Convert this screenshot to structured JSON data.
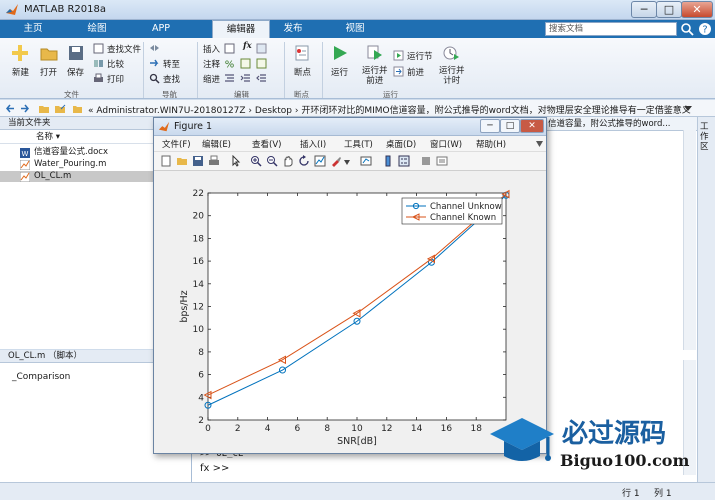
{
  "window": {
    "title": "MATLAB R2018a",
    "min_label": "─",
    "max_label": "□",
    "close_label": "✕"
  },
  "ribbon_tabs": [
    {
      "label": "主页"
    },
    {
      "label": "绘图"
    },
    {
      "label": "APP"
    },
    {
      "label": "编辑器"
    },
    {
      "label": "发布"
    },
    {
      "label": "视图"
    }
  ],
  "search": {
    "placeholder": "搜索文档"
  },
  "ribbon": {
    "file_group": {
      "label": "文件",
      "new": "新建",
      "open": "打开",
      "save": "保存",
      "find_files": "查找文件",
      "compare": "比较",
      "print": "打印"
    },
    "nav_group": {
      "label": "导航",
      "goto": "转至",
      "find": "查找"
    },
    "edit_group": {
      "label": "编辑",
      "insert": "插入",
      "comment": "注释",
      "indent": "缩进",
      "fx": "fx"
    },
    "breakpoint_group": {
      "label": "断点",
      "breakpoints": "断点"
    },
    "run_group": {
      "label": "运行",
      "run": "运行",
      "run_advance": "运行并\n前进",
      "run_section": "运行节",
      "advance": "前进",
      "run_time": "运行并\n计时"
    }
  },
  "address": {
    "path": "« Administrator.WIN7U-20180127Z › Desktop › 开环闭环对比的MIMO信道容量，附公式推导的word文档，对物理层安全理论推导有一定借鉴意义"
  },
  "current_folder": {
    "header": "当前文件夹",
    "column": "名称 ▾",
    "files": [
      {
        "name": "信道容量公式.docx",
        "icon": "word-doc-icon"
      },
      {
        "name": "Water_Pouring.m",
        "icon": "matlab-file-icon"
      },
      {
        "name": "OL_CL.m",
        "icon": "matlab-file-icon",
        "selected": true
      }
    ]
  },
  "details": {
    "header": "OL_CL.m （脚本）",
    "text": "_Comparison"
  },
  "editor": {
    "tab_text": "信道容量，附公式推导的word..."
  },
  "workspace": {
    "label": "工作区"
  },
  "command": {
    "prev_line": ">> OL_CL",
    "prompt": "fx >>"
  },
  "status": {
    "row_label": "行",
    "row_value": "1",
    "col_label": "列",
    "col_value": "1"
  },
  "figure": {
    "title": "Figure 1",
    "menus": [
      "文件(F)",
      "编辑(E)",
      "查看(V)",
      "插入(I)",
      "工具(T)",
      "桌面(D)",
      "窗口(W)",
      "帮助(H)"
    ]
  },
  "colors": {
    "blue_series": "#0072bd",
    "red_series": "#d95319",
    "ribbon_blue": "#1f6fb2"
  },
  "chart_data": {
    "type": "line",
    "title": "",
    "xlabel": "SNR[dB]",
    "ylabel": "bps/Hz",
    "xlim": [
      0,
      20
    ],
    "ylim": [
      2,
      22
    ],
    "xticks": [
      0,
      2,
      4,
      6,
      8,
      10,
      12,
      14,
      16,
      18
    ],
    "yticks": [
      2,
      4,
      6,
      8,
      10,
      12,
      14,
      16,
      18,
      20,
      22
    ],
    "legend_position": "top-right",
    "grid": false,
    "series": [
      {
        "name": "Channel Unknow",
        "marker": "circle",
        "color": "#0072bd",
        "x": [
          0,
          5,
          10,
          15,
          20
        ],
        "y": [
          3.3,
          6.4,
          10.7,
          15.9,
          21.8
        ]
      },
      {
        "name": "Channel Known",
        "marker": "triangle-left",
        "color": "#d95319",
        "x": [
          0,
          5,
          10,
          15,
          20
        ],
        "y": [
          4.2,
          7.3,
          11.4,
          16.2,
          21.9
        ]
      }
    ]
  },
  "logo": {
    "text": "必过源码",
    "url_text": "Biguo100.com"
  }
}
